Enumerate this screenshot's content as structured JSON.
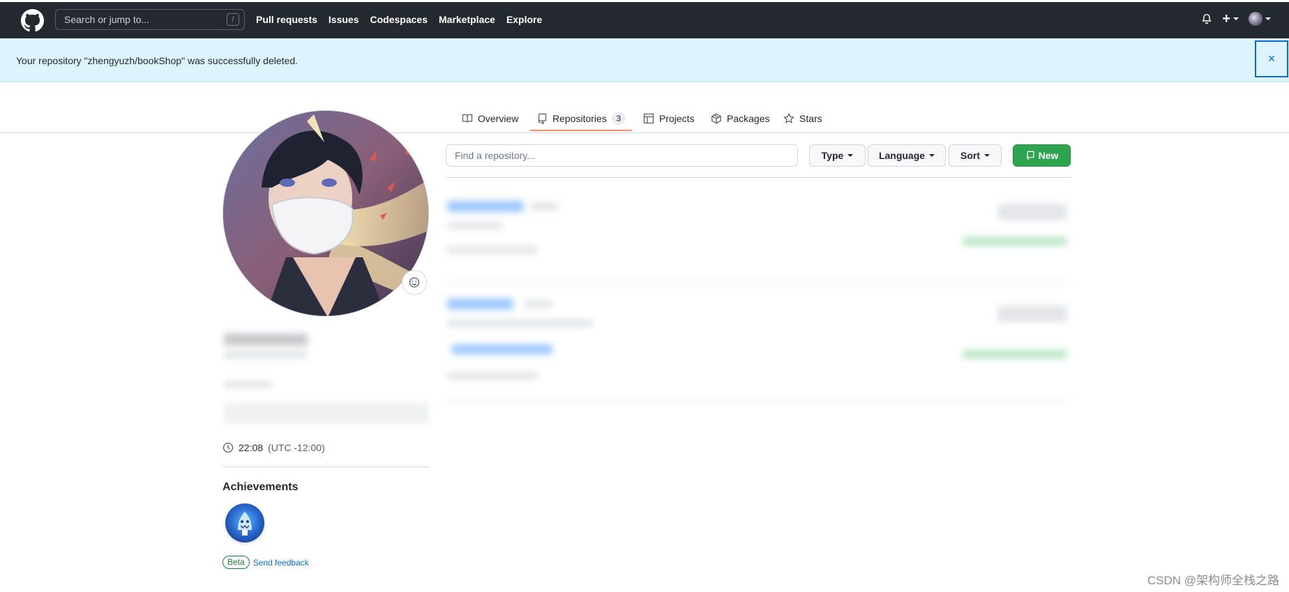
{
  "header": {
    "search_placeholder": "Search or jump to...",
    "search_shortcut": "/",
    "nav": [
      "Pull requests",
      "Issues",
      "Codespaces",
      "Marketplace",
      "Explore"
    ],
    "plus_label": "+"
  },
  "flash": {
    "message": "Your repository \"zhengyuzh/bookShop\" was successfully deleted.",
    "close_label": "×"
  },
  "tabs": {
    "overview": "Overview",
    "repositories": "Repositories",
    "repositories_count": "3",
    "projects": "Projects",
    "packages": "Packages",
    "stars": "Stars"
  },
  "profile": {
    "local_time": "22:08",
    "timezone": "(UTC -12:00)",
    "achievements_title": "Achievements",
    "beta_label": "Beta",
    "feedback_label": "Send feedback"
  },
  "repos": {
    "find_placeholder": "Find a repository...",
    "type_label": "Type",
    "language_label": "Language",
    "sort_label": "Sort",
    "new_label": "New"
  },
  "watermark": "CSDN @架构师全栈之路",
  "colors": {
    "header_bg": "#24292f",
    "flash_bg": "#ddf4ff",
    "accent_blue": "#0969da",
    "new_button_green": "#2da44e",
    "tab_underline": "#fd8c73"
  }
}
